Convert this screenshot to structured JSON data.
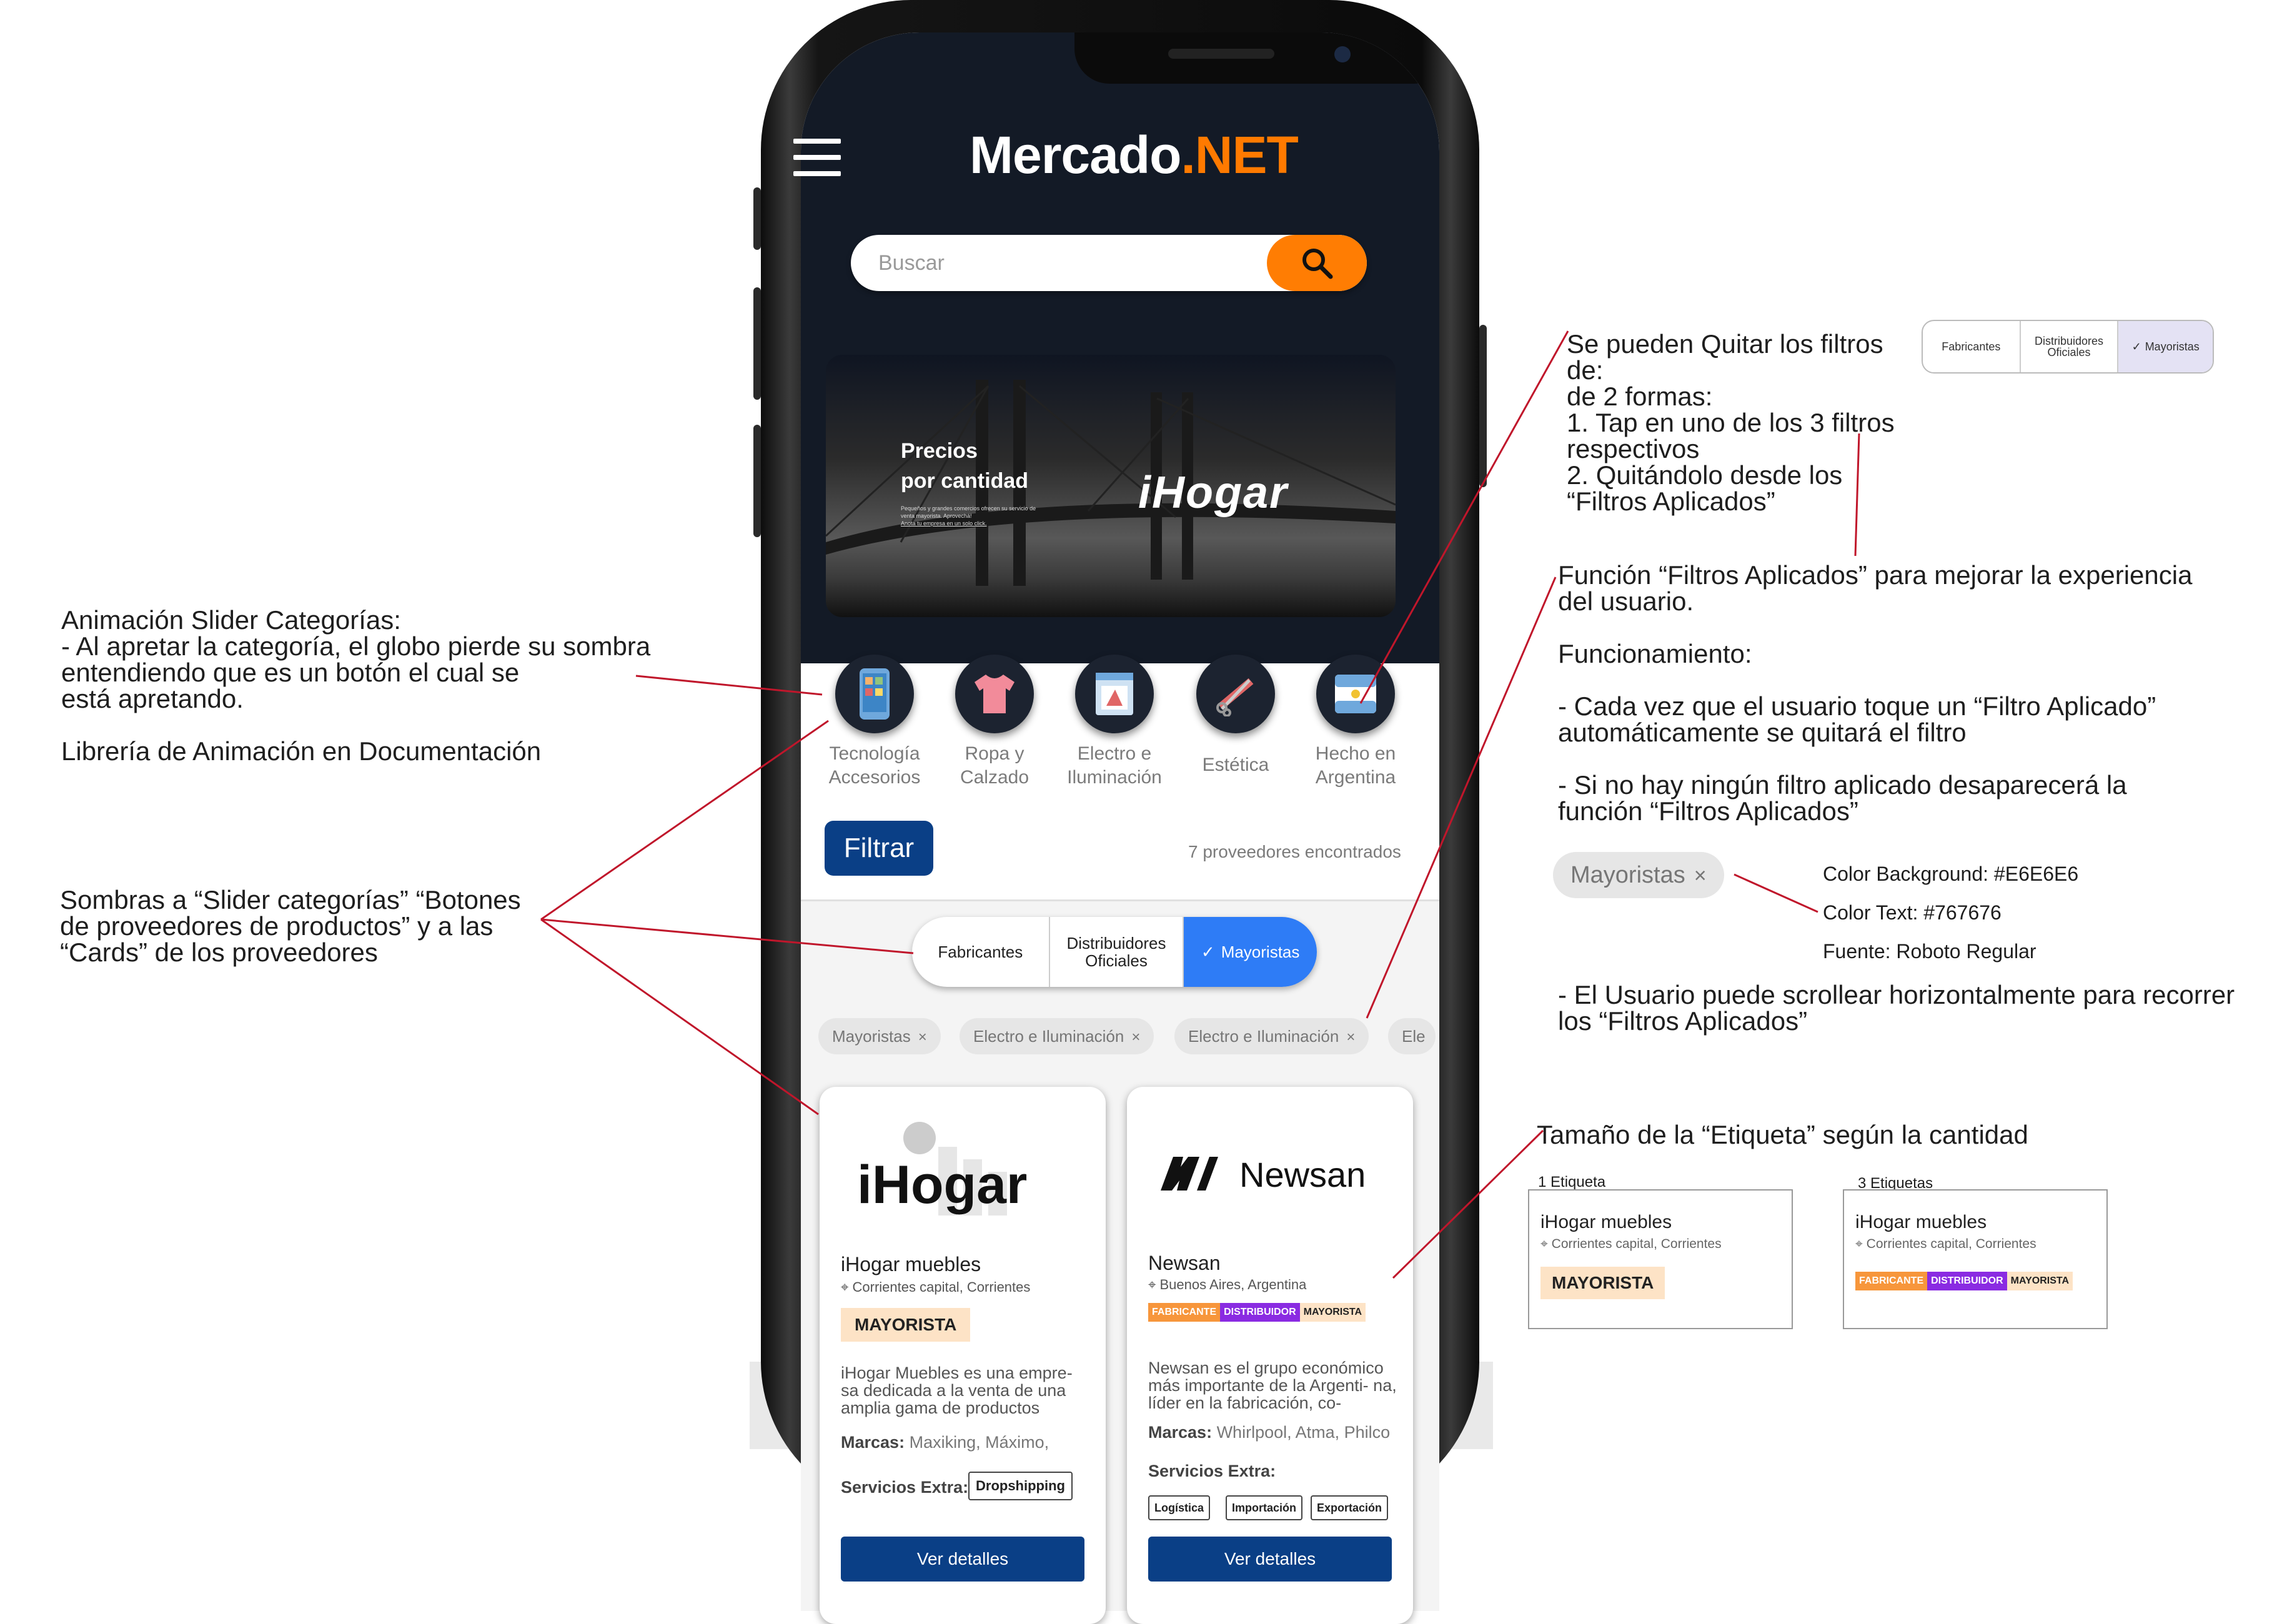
{
  "app": {
    "logo_main": "Mercado",
    "logo_accent": ".NET"
  },
  "search": {
    "placeholder": "Buscar"
  },
  "banner": {
    "title_line1": "Precios",
    "title_line2": "por cantidad",
    "small_text": "Pequeños y grandes comercios ofrecen su servicio de venta mayorista. Aprovechá!",
    "small_link": "Anota tu empresa en un solo click.",
    "brand": "iHogar"
  },
  "categories": [
    {
      "label": "Tecnología Accesorios",
      "icon": "phone-icon"
    },
    {
      "label": "Ropa y Calzado",
      "icon": "tshirt-icon"
    },
    {
      "label": "Electro e Iluminación",
      "icon": "appliance-icon"
    },
    {
      "label": "Estética",
      "icon": "comb-scissors-icon"
    },
    {
      "label": "Hecho en Argentina",
      "icon": "argentina-flag-icon"
    }
  ],
  "filter_bar": {
    "button": "Filtrar",
    "count": "7 proveedores encontrados"
  },
  "segment": {
    "fabricantes": "Fabricantes",
    "distribuidores": "Distribuidores Oficiales",
    "mayoristas": "Mayoristas",
    "check": "✓"
  },
  "applied_chips": [
    {
      "label": "Mayoristas",
      "remove": "×"
    },
    {
      "label": "Electro e Iluminación",
      "remove": "×"
    },
    {
      "label": "Electro e Iluminación",
      "remove": "×"
    },
    {
      "label": "Ele",
      "remove": ""
    }
  ],
  "cards": [
    {
      "logo": "iHogar",
      "name": "iHogar muebles",
      "location": "Corrientes capital, Corrientes",
      "tag": "MAYORISTA",
      "description": "iHogar Muebles es una empre- sa dedicada a la venta de una amplia gama de productos",
      "marcas_label": "Marcas:",
      "marcas": "Maxiking, Máximo,",
      "servicios_label": "Servicios Extra:",
      "servicios": [
        "Dropshipping"
      ],
      "button": "Ver detalles"
    },
    {
      "logo": "Newsan",
      "name": "Newsan",
      "location": "Buenos Aires, Argentina",
      "tags": [
        "FABRICANTE",
        "DISTRIBUIDOR",
        "MAYORISTA"
      ],
      "description": "Newsan es el grupo económico más importante de la Argenti- na, líder en la fabricación, co-",
      "marcas_label": "Marcas:",
      "marcas": "Whirlpool, Atma, Philco",
      "servicios_label": "Servicios Extra:",
      "servicios": [
        "Logística",
        "Importación",
        "Exportación"
      ],
      "button": "Ver detalles"
    }
  ],
  "annotations": {
    "slider": "Animación Slider Categorías:\n- Al apretar la categoría, el globo pierde su sombra\nentendiendo que es un botón el cual se\nestá apretando.\n\nLibrería de Animación en Documentación",
    "shadows": "Sombras a “Slider categorías” “Botones\nde proveedores de productos” y a las\n“Cards” de los proveedores",
    "remove_filters": "Se pueden Quitar los filtros de:\nde 2 formas:\n 1. Tap en uno de los 3 filtros respectivos\n 2. Quitándolo desde los “Filtros Aplicados”",
    "applied_filters": "Función “Filtros Aplicados” para mejorar la experiencia\ndel usuario.\n\nFuncionamiento:\n\n- Cada vez que el usuario toque un “Filtro Aplicado”\nautomáticamente se quitará el filtro\n\n- Si no hay ningún filtro aplicado desaparecerá la\nfunción “Filtros Aplicados”",
    "chip_example": "Mayoristas",
    "chip_x": "×",
    "color_bg": "Color Background: #E6E6E6",
    "color_text": "Color Text: #767676",
    "font": "Fuente: Roboto Regular",
    "scroll": "- El Usuario puede scrollear horizontalmente para recorrer\nlos “Filtros Aplicados”",
    "tag_size": "Tamaño de la “Etiqueta” según la cantidad",
    "one_tag": "1 Etiqueta",
    "three_tags": "3 Etiquetas",
    "example_name": "iHogar muebles",
    "example_location": "Corrientes capital, Corrientes",
    "example_tag": "MAYORISTA",
    "example_tags": [
      "FABRICANTE",
      "DISTRIBUIDOR",
      "MAYORISTA"
    ],
    "legend_seg": {
      "a": "Fabricantes",
      "b": "Distribuidores Oficiales",
      "c": "Mayoristas",
      "check": "✓"
    }
  },
  "colors": {
    "accent_orange": "#FF7A00",
    "primary_blue": "#0A3F86",
    "segment_blue": "#2E7CF6",
    "chip_bg": "#E6E6E6",
    "chip_text": "#767676",
    "annotation_line": "#C0162B"
  }
}
